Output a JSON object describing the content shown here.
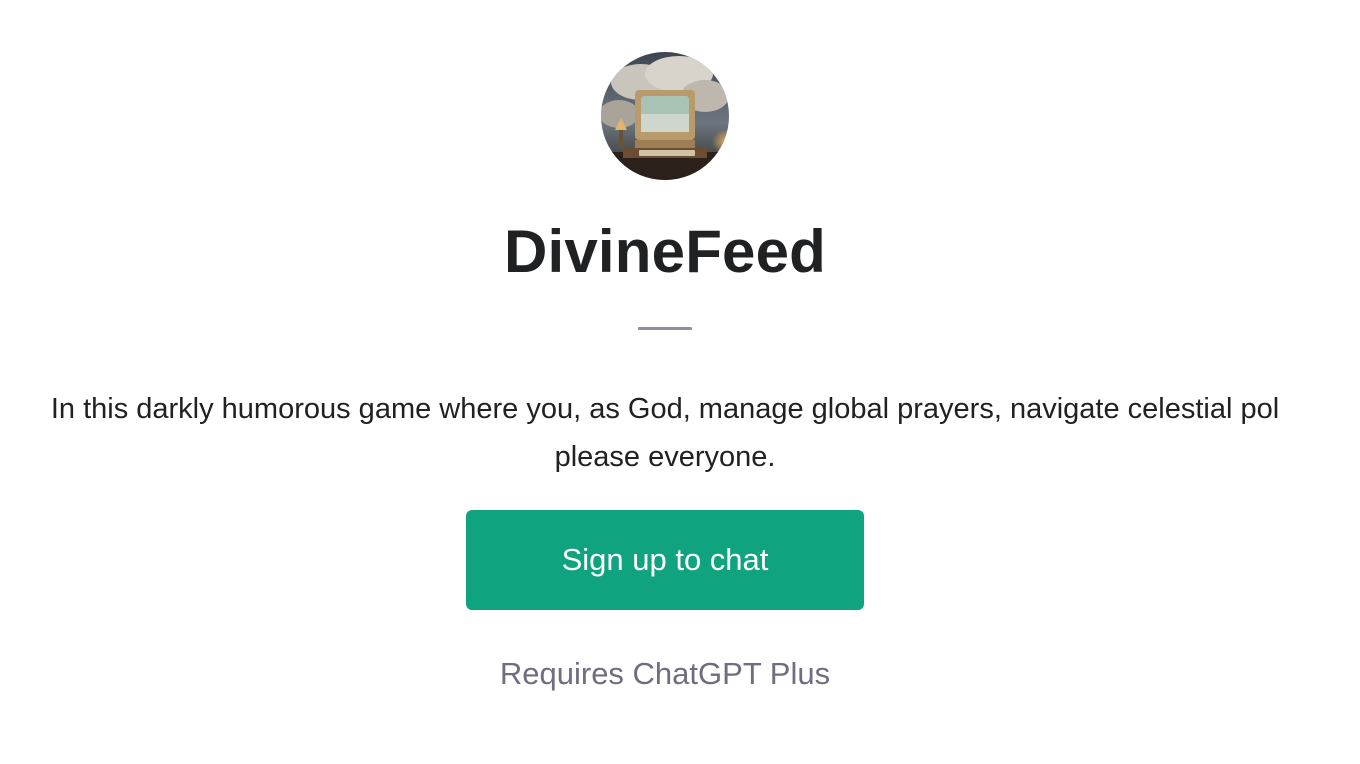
{
  "gpt": {
    "avatar_icon": "retro-computer-clouds-avatar",
    "name": "DivineFeed",
    "description_line1": "Engage in this darkly humorous game where you, as God, manage global prayers, navigate celestial politics, and try to please everyone.",
    "description_line1_visible": "In this darkly humorous game where you, as God, manage global prayers, navigate celestial pol",
    "description_line2": "please everyone."
  },
  "actions": {
    "signup_label": "Sign up to chat",
    "signup_color": "#10a37f"
  },
  "footer": {
    "requirement": "Requires ChatGPT Plus"
  }
}
